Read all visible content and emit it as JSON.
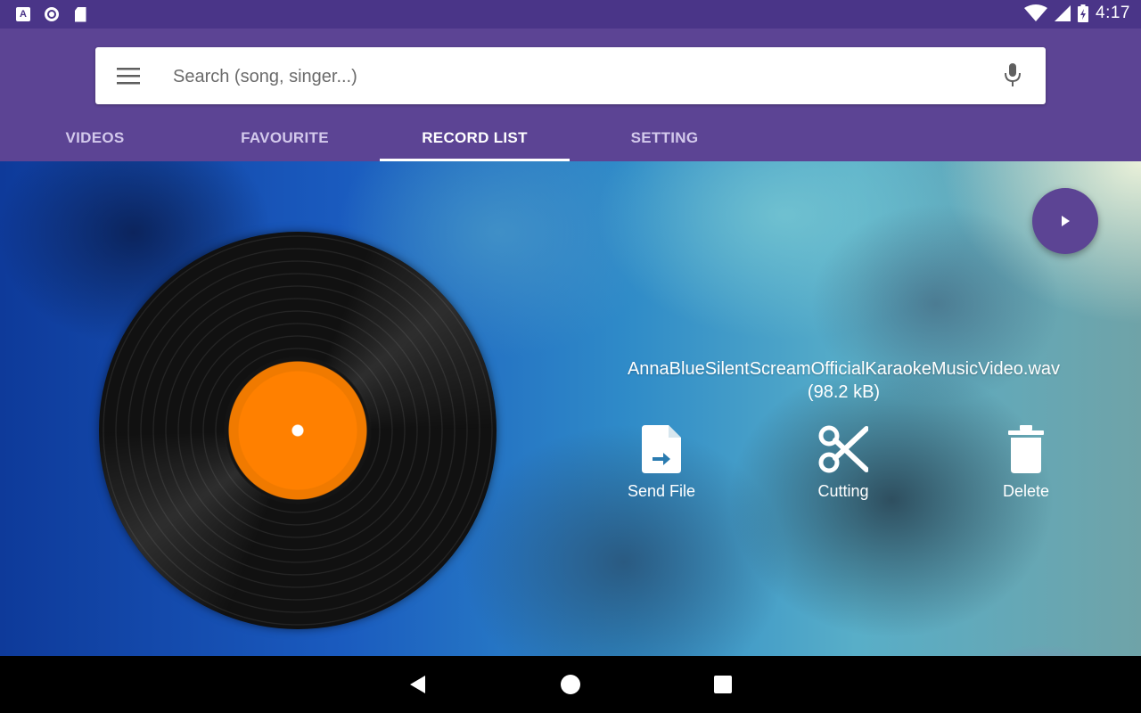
{
  "status_bar": {
    "notification_icons": [
      "a-icon",
      "circle-app-icon",
      "sd-card-icon"
    ],
    "system_icons": [
      "wifi-icon",
      "signal-icon",
      "battery-charging-icon"
    ],
    "time": "4:17",
    "accent": "#4a3588"
  },
  "search": {
    "placeholder": "Search (song, singer...)",
    "value": ""
  },
  "tabs": [
    {
      "label": "VIDEOS",
      "active": false
    },
    {
      "label": "FAVOURITE",
      "active": false
    },
    {
      "label": "RECORD LIST",
      "active": true
    },
    {
      "label": "SETTING",
      "active": false
    }
  ],
  "colors": {
    "primary": "#5c4494",
    "vinyl_label": "#ff8000"
  },
  "record": {
    "file_name": "AnnaBlueSilentScreamOfficialKaraokeMusicVideo.wav",
    "file_size": "(98.2 kB)"
  },
  "actions": {
    "send_file": "Send File",
    "cutting": "Cutting",
    "delete": "Delete"
  },
  "navigation": [
    "back-icon",
    "home-icon",
    "recents-icon"
  ]
}
